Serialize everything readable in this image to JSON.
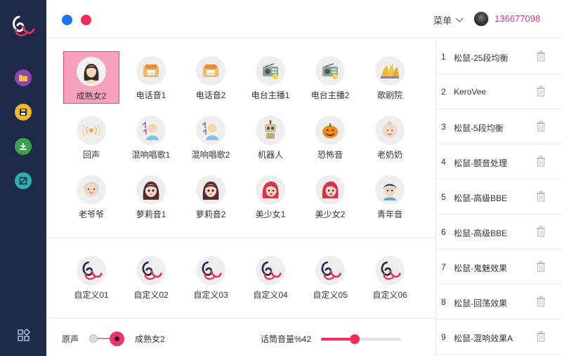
{
  "header": {
    "menu_label": "菜单",
    "phone": "136677098"
  },
  "sidebar": {
    "items": [
      {
        "icon": "folder-icon",
        "color": "#8e44ad"
      },
      {
        "icon": "save-icon",
        "color": "#f0b82b"
      },
      {
        "icon": "download-icon",
        "color": "#3aa34a"
      },
      {
        "icon": "block-icon",
        "color": "#2ab0b0"
      }
    ],
    "bottom_icon": "apps-icon"
  },
  "voices": [
    {
      "label": "成熟女2",
      "icon": "woman-icon",
      "selected": true
    },
    {
      "label": "电话音1",
      "icon": "phone-icon"
    },
    {
      "label": "电话音2",
      "icon": "phone-icon"
    },
    {
      "label": "电台主播1",
      "icon": "radio-icon"
    },
    {
      "label": "电台主播2",
      "icon": "radio-icon"
    },
    {
      "label": "歌剧院",
      "icon": "opera-icon"
    },
    {
      "label": "回声",
      "icon": "echo-icon"
    },
    {
      "label": "混响唱歌1",
      "icon": "singer-icon"
    },
    {
      "label": "混响唱歌2",
      "icon": "singer-icon"
    },
    {
      "label": "机器人",
      "icon": "robot-icon"
    },
    {
      "label": "恐怖音",
      "icon": "pumpkin-icon"
    },
    {
      "label": "老奶奶",
      "icon": "grandma-icon"
    },
    {
      "label": "老爷爷",
      "icon": "grandpa-icon"
    },
    {
      "label": "萝莉音1",
      "icon": "girl-icon"
    },
    {
      "label": "萝莉音2",
      "icon": "girl-icon"
    },
    {
      "label": "美少女1",
      "icon": "beauty-icon"
    },
    {
      "label": "美少女2",
      "icon": "beauty-icon"
    },
    {
      "label": "青年音",
      "icon": "youth-icon"
    }
  ],
  "custom": [
    {
      "label": "自定义01"
    },
    {
      "label": "自定义02"
    },
    {
      "label": "自定义03"
    },
    {
      "label": "自定义04"
    },
    {
      "label": "自定义05"
    },
    {
      "label": "自定义06"
    }
  ],
  "bottom": {
    "original_label": "原声",
    "current_voice": "成熟女2",
    "volume_label": "话筒音量%42",
    "volume_fraction": 0.42
  },
  "presets": [
    {
      "num": "1",
      "name": "松鼠-25段均衡"
    },
    {
      "num": "2",
      "name": "KeroVee"
    },
    {
      "num": "3",
      "name": "松鼠-5段均衡"
    },
    {
      "num": "4",
      "name": "松鼠-颤音处理"
    },
    {
      "num": "5",
      "name": "松鼠-高级BBE"
    },
    {
      "num": "6",
      "name": "松鼠-高级BBE"
    },
    {
      "num": "7",
      "name": "松鼠-鬼魅效果"
    },
    {
      "num": "8",
      "name": "松鼠-回荡效果"
    },
    {
      "num": "9",
      "name": "松鼠-混响效果A"
    }
  ],
  "colors": {
    "accent": "#ee2d5f",
    "sidebar": "#1f2a4a",
    "blue": "#1e74ee"
  }
}
